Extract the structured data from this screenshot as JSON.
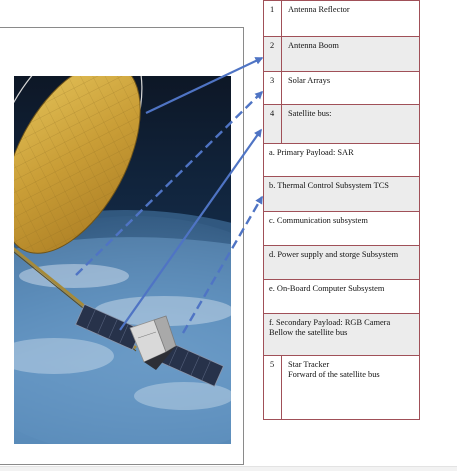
{
  "legend": {
    "rows": [
      {
        "num": "1",
        "label": "Antenna Reflector",
        "shaded": false
      },
      {
        "num": "2",
        "label": "Antenna Boom",
        "shaded": true
      },
      {
        "num": "3",
        "label": "Solar Arrays",
        "shaded": false
      },
      {
        "num": "4",
        "label": "Satellite bus:",
        "shaded": true
      },
      {
        "num": "",
        "label": "a. Primary Payload: SAR",
        "shaded": false
      },
      {
        "num": "",
        "label": "b. Thermal Control Subsystem TCS",
        "shaded": true
      },
      {
        "num": "",
        "label": "c. Communication subsystem",
        "shaded": false
      },
      {
        "num": "",
        "label": "d. Power supply and storge Subsystem",
        "shaded": true
      },
      {
        "num": "",
        "label": "e. On-Board Computer Subsystem",
        "shaded": false
      },
      {
        "num": "",
        "label": "f. Secondary Payload: RGB Camera\nBellow the satellite bus",
        "shaded": true
      },
      {
        "num": "5",
        "label": "Star Tracker\nForward of the satellite bus",
        "shaded": false
      }
    ]
  },
  "figure": {
    "image_description": "satellite-with-deployable-antenna-reflector-over-earth",
    "arrow_color": "#4f74c4"
  }
}
